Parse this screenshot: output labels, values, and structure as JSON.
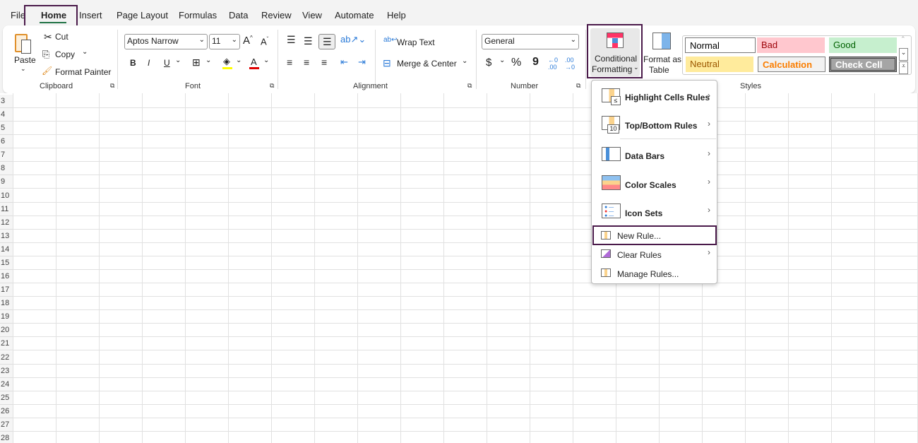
{
  "tabs": [
    "File",
    "Home",
    "Insert",
    "Page Layout",
    "Formulas",
    "Data",
    "Review",
    "View",
    "Automate",
    "Help"
  ],
  "active_tab": "Home",
  "clipboard": {
    "paste": "Paste",
    "cut": "Cut",
    "copy": "Copy",
    "format_painter": "Format Painter",
    "group": "Clipboard"
  },
  "font": {
    "name": "Aptos Narrow",
    "size": "11",
    "group": "Font",
    "bold": "B",
    "italic": "I",
    "underline": "U",
    "fill_color": "#ffff00",
    "font_color": "#e00000"
  },
  "alignment": {
    "wrap_text": "Wrap Text",
    "merge_center": "Merge & Center",
    "group": "Alignment"
  },
  "number": {
    "format": "General",
    "currency": "$",
    "percent": "%",
    "comma": "9",
    "group": "Number"
  },
  "styles": {
    "conditional_formatting": [
      "Conditional",
      "Formatting"
    ],
    "format_as_table": [
      "Format as",
      "Table"
    ],
    "group": "Styles",
    "cells": [
      {
        "label": "Normal",
        "bg": "#ffffff",
        "fg": "#000000"
      },
      {
        "label": "Bad",
        "bg": "#ffc7ce",
        "fg": "#9c0006"
      },
      {
        "label": "Good",
        "bg": "#c6efce",
        "fg": "#006100"
      },
      {
        "label": "Neutral",
        "bg": "#ffeb9c",
        "fg": "#9c5700"
      },
      {
        "label": "Calculation",
        "bg": "#f2f2f2",
        "fg": "#fa7d00"
      },
      {
        "label": "Check Cell",
        "bg": "#a5a5a5",
        "fg": "#ffffff"
      }
    ]
  },
  "rows": [
    "3",
    "4",
    "5",
    "6",
    "7",
    "8",
    "9",
    "10",
    "11",
    "12",
    "13",
    "14",
    "15",
    "16",
    "17",
    "18",
    "19",
    "20",
    "21",
    "22",
    "23",
    "24",
    "25",
    "26",
    "27",
    "28"
  ],
  "menu": {
    "items": [
      {
        "label": "Highlight Cells Rules",
        "icon": "highlight-cells-icon",
        "submenu": true
      },
      {
        "label": "Top/Bottom Rules",
        "icon": "top-bottom-icon",
        "submenu": true
      },
      {
        "label": "Data Bars",
        "icon": "data-bars-icon",
        "submenu": true
      },
      {
        "label": "Color Scales",
        "icon": "color-scales-icon",
        "submenu": true
      },
      {
        "label": "Icon Sets",
        "icon": "icon-sets-icon",
        "submenu": true
      }
    ],
    "small_items": [
      {
        "label": "New Rule...",
        "icon": "new-rule-icon",
        "submenu": false
      },
      {
        "label": "Clear Rules",
        "icon": "clear-rules-icon",
        "submenu": true
      },
      {
        "label": "Manage Rules...",
        "icon": "manage-rules-icon",
        "submenu": false
      }
    ]
  },
  "highlight_color": "#4a1a4a"
}
